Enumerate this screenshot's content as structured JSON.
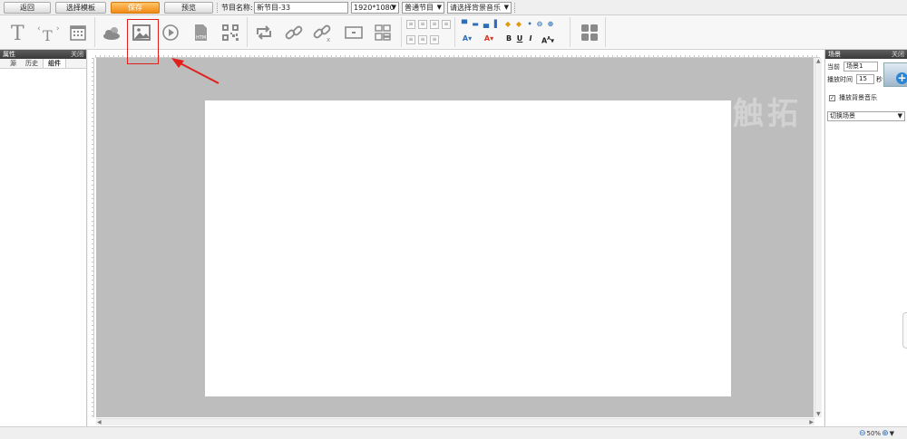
{
  "topbar": {
    "back": "返回",
    "select_template": "选择模板",
    "save": "保存",
    "preview": "预览",
    "program_name_label": "节目名称:",
    "program_name_value": "新节目-33",
    "resolution": "1920*1080",
    "program_type": "普通节目",
    "bg_music_placeholder": "请选择背景音乐"
  },
  "toolbar": {
    "icons": [
      "text-icon",
      "scroll-text-icon",
      "calendar-icon",
      "weather-icon",
      "image-icon",
      "video-icon",
      "html-icon",
      "qrcode-icon",
      "loop-icon",
      "link-icon",
      "unlink-icon",
      "screen-icon",
      "layout-icon",
      "grid-icon"
    ],
    "align_buttons": [
      "░",
      "▒",
      "▓",
      "▓",
      "░",
      "▒",
      "▓"
    ],
    "format_labels": [
      "B",
      "U",
      "I"
    ]
  },
  "left_panel": {
    "title": "属性",
    "close": "关闭",
    "tabs": [
      "源",
      "历史",
      "组件"
    ],
    "active_tab": "组件"
  },
  "canvas": {
    "watermark": "触拓"
  },
  "right_panel": {
    "title": "场景",
    "close": "关闭",
    "current_label": "当前",
    "current_value": "场景1",
    "duration_label": "播放时间",
    "duration_value": "15",
    "duration_unit": "秒",
    "play_bg_music": "播放背景音乐",
    "play_bg_music_checked": true,
    "switch_scene": "切换场景"
  },
  "status": {
    "zoom": "50%"
  },
  "colors": {
    "accent": "#f08a14",
    "highlight": "#e0201a",
    "stage": "#bdbdbd"
  }
}
